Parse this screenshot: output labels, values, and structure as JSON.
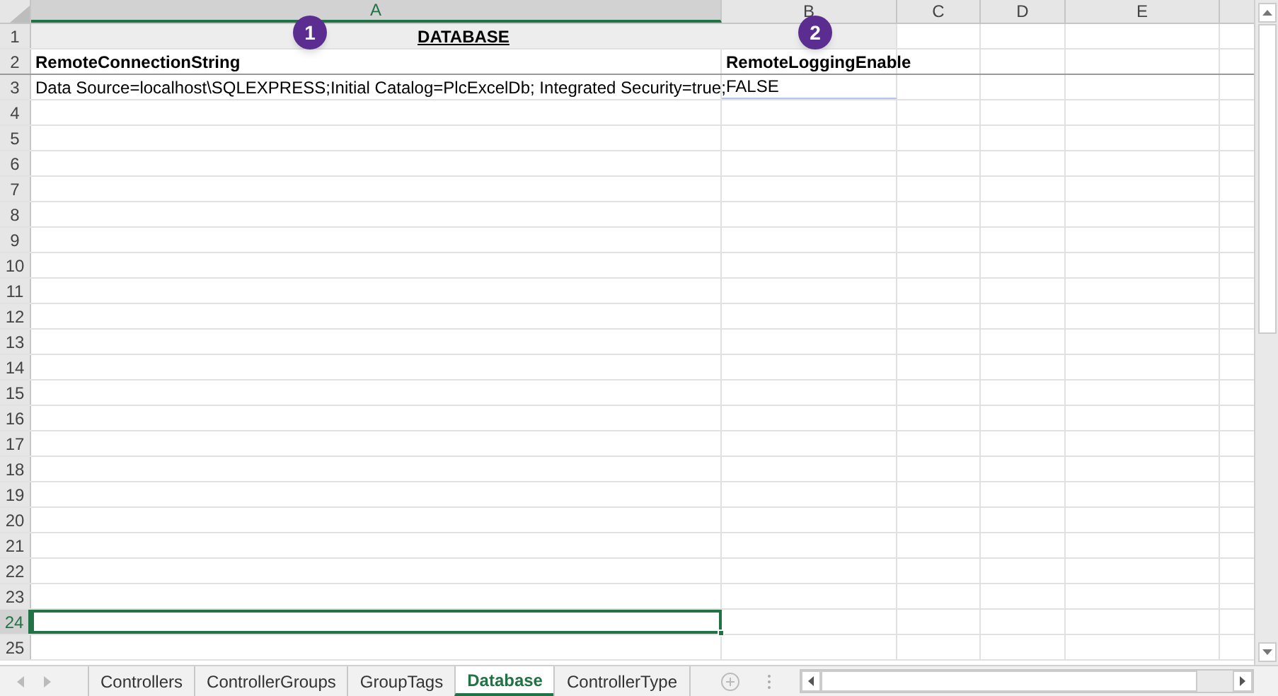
{
  "columns": [
    {
      "label": "A",
      "selected": true
    },
    {
      "label": "B",
      "selected": false
    },
    {
      "label": "C",
      "selected": false
    },
    {
      "label": "D",
      "selected": false
    },
    {
      "label": "E",
      "selected": false
    }
  ],
  "rows": [
    {
      "number": "1",
      "selected": false,
      "cells": [
        {
          "kind": "merged-title",
          "text": "DATABASE"
        }
      ]
    },
    {
      "number": "2",
      "selected": false,
      "cells": [
        {
          "kind": "header",
          "text": "RemoteConnectionString"
        },
        {
          "kind": "header",
          "text": "RemoteLoggingEnable"
        }
      ]
    },
    {
      "number": "3",
      "selected": false,
      "cells": [
        {
          "kind": "value",
          "text": "Data Source=localhost\\SQLEXPRESS;Initial Catalog=PlcExcelDb; Integrated Security=true;"
        },
        {
          "kind": "value",
          "text": "FALSE"
        }
      ]
    },
    {
      "number": "4",
      "selected": false
    },
    {
      "number": "5",
      "selected": false
    },
    {
      "number": "6",
      "selected": false
    },
    {
      "number": "7",
      "selected": false
    },
    {
      "number": "8",
      "selected": false
    },
    {
      "number": "9",
      "selected": false
    },
    {
      "number": "10",
      "selected": false
    },
    {
      "number": "11",
      "selected": false
    },
    {
      "number": "12",
      "selected": false
    },
    {
      "number": "13",
      "selected": false
    },
    {
      "number": "14",
      "selected": false
    },
    {
      "number": "15",
      "selected": false
    },
    {
      "number": "16",
      "selected": false
    },
    {
      "number": "17",
      "selected": false
    },
    {
      "number": "18",
      "selected": false
    },
    {
      "number": "19",
      "selected": false
    },
    {
      "number": "20",
      "selected": false
    },
    {
      "number": "21",
      "selected": false
    },
    {
      "number": "22",
      "selected": false
    },
    {
      "number": "23",
      "selected": false
    },
    {
      "number": "24",
      "selected": true
    },
    {
      "number": "25",
      "selected": false
    }
  ],
  "callouts": [
    {
      "number": "1"
    },
    {
      "number": "2"
    }
  ],
  "sheet_tabs": [
    {
      "label": "Controllers",
      "selected": false
    },
    {
      "label": "ControllerGroups",
      "selected": false
    },
    {
      "label": "GroupTags",
      "selected": false
    },
    {
      "label": "Database",
      "selected": true
    },
    {
      "label": "ControllerType",
      "selected": false
    }
  ]
}
